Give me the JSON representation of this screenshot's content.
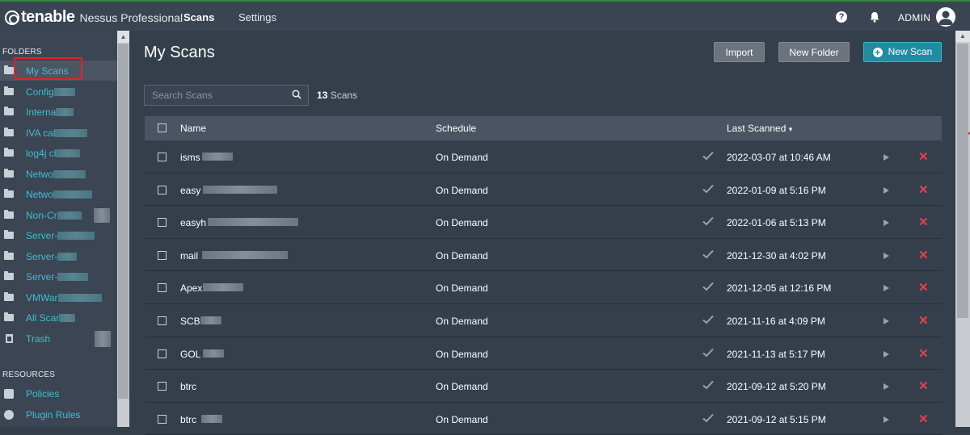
{
  "app": {
    "brand": "tenable",
    "product": "Nessus Professional",
    "nav": [
      "Scans",
      "Settings"
    ],
    "user": "ADMIN",
    "help_glyph": "?"
  },
  "sidebar": {
    "folders_title": "FOLDERS",
    "folders": [
      {
        "label": "My Scans",
        "selected": true
      },
      {
        "label": "Config"
      },
      {
        "label": "Interna"
      },
      {
        "label": "IVA cal"
      },
      {
        "label": "log4j cl"
      },
      {
        "label": "Netwo"
      },
      {
        "label": "Netwo"
      },
      {
        "label": "Non-Cr"
      },
      {
        "label": "Server-"
      },
      {
        "label": "Server-"
      },
      {
        "label": "Server-"
      },
      {
        "label": "VMWar"
      },
      {
        "label": "All Scar"
      },
      {
        "label": "Trash"
      }
    ],
    "resources_title": "RESOURCES",
    "resources": [
      {
        "label": "Policies"
      },
      {
        "label": "Plugin Rules"
      }
    ]
  },
  "main": {
    "title": "My Scans",
    "buttons": {
      "import": "Import",
      "new_folder": "New Folder",
      "new_scan": "New Scan"
    },
    "search_placeholder": "Search Scans",
    "scan_count_number": "13",
    "scan_count_label": "Scans",
    "columns": {
      "name": "Name",
      "schedule": "Schedule",
      "last_scanned": "Last Scanned",
      "sort_glyph": "▾"
    },
    "rows": [
      {
        "name": "isms",
        "schedule": "On Demand",
        "last_scanned": "2022-03-07 at 10:46 AM"
      },
      {
        "name": "easy",
        "schedule": "On Demand",
        "last_scanned": "2022-01-09 at 5:16 PM"
      },
      {
        "name": "easyh",
        "schedule": "On Demand",
        "last_scanned": "2022-01-06 at 5:13 PM"
      },
      {
        "name": "mail",
        "schedule": "On Demand",
        "last_scanned": "2021-12-30 at 4:02 PM"
      },
      {
        "name": "Apex",
        "schedule": "On Demand",
        "last_scanned": "2021-12-05 at 12:16 PM"
      },
      {
        "name": "SCB",
        "schedule": "On Demand",
        "last_scanned": "2021-11-16 at 4:09 PM"
      },
      {
        "name": "GOL",
        "schedule": "On Demand",
        "last_scanned": "2021-11-13 at 5:17 PM"
      },
      {
        "name": "btrc",
        "schedule": "On Demand",
        "last_scanned": "2021-09-12 at 5:20 PM"
      },
      {
        "name": "btrc",
        "schedule": "On Demand",
        "last_scanned": "2021-09-12 at 5:15 PM"
      }
    ]
  },
  "colors": {
    "accent": "#1e8da0",
    "link": "#3fbfd2",
    "delete": "#e8404a",
    "highlight": "#e8202a"
  }
}
